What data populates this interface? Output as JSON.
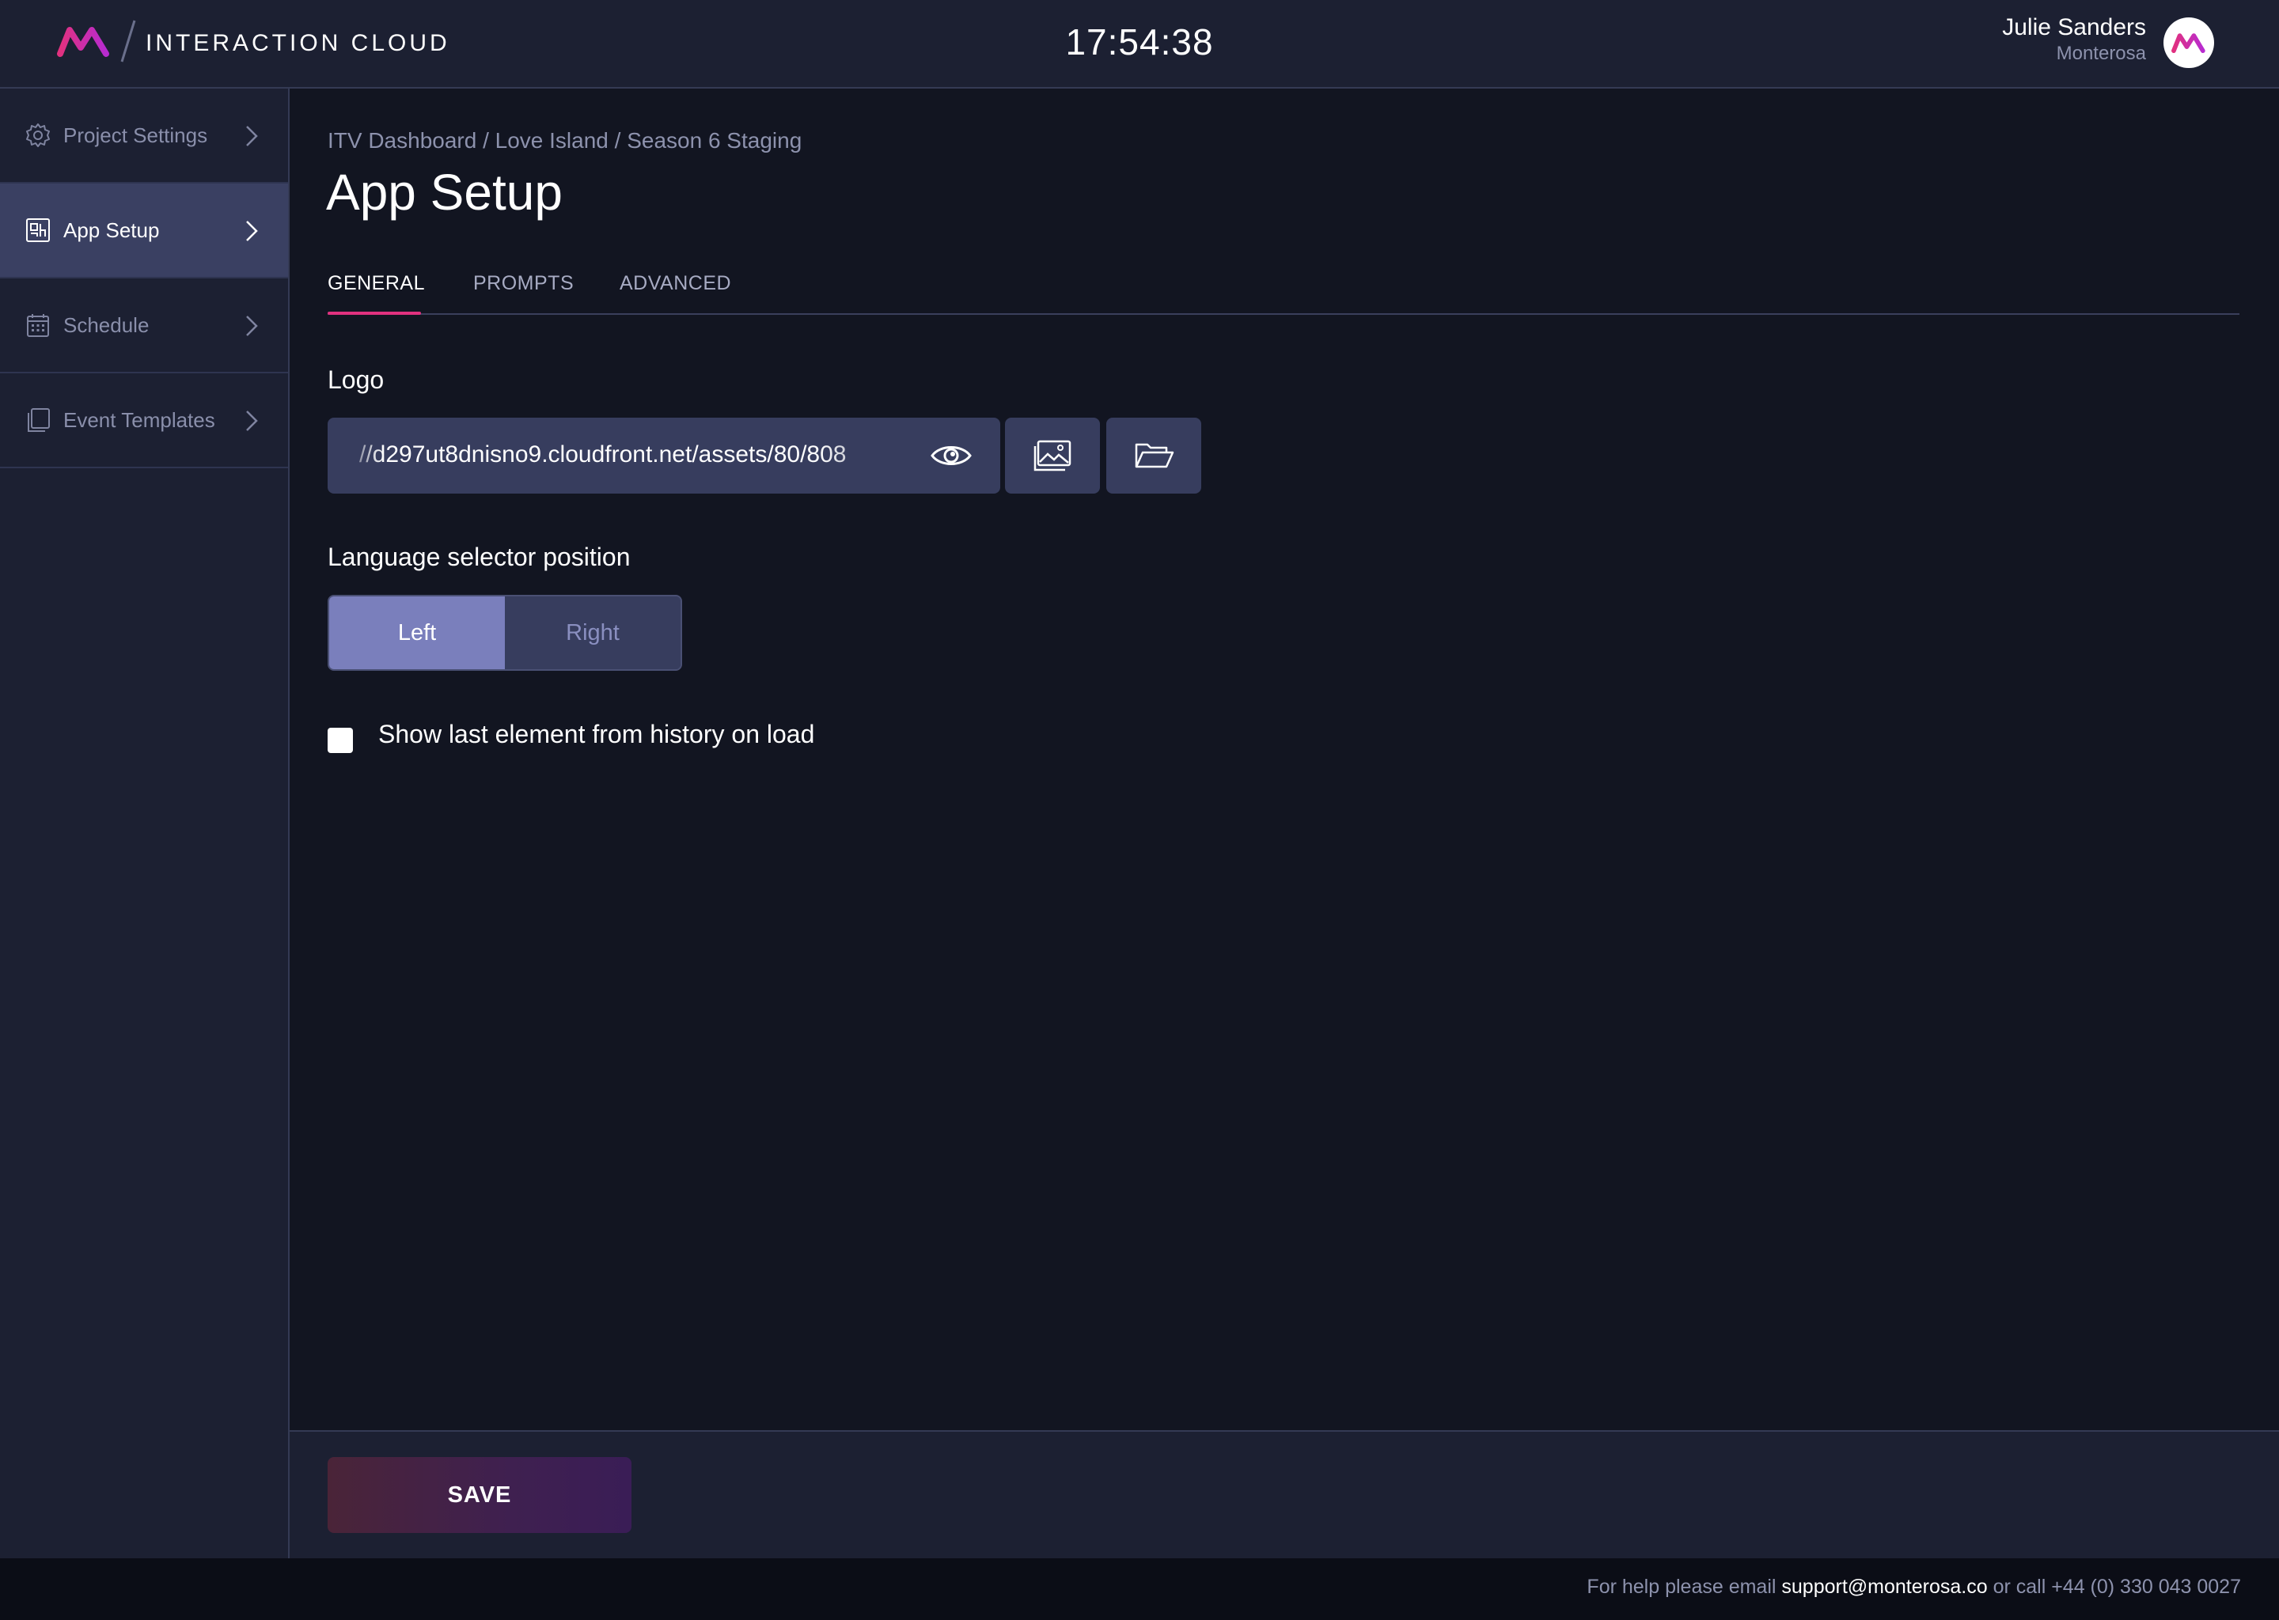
{
  "header": {
    "brand_name": "INTERACTION CLOUD",
    "clock": "17:54:38",
    "user_name": "Julie Sanders",
    "user_org": "Monterosa",
    "accent_color": "#e1317f"
  },
  "sidebar": {
    "items": [
      {
        "label": "Project Settings",
        "icon": "gear-icon",
        "active": false
      },
      {
        "label": "App Setup",
        "icon": "app-setup-icon",
        "active": true
      },
      {
        "label": "Schedule",
        "icon": "calendar-icon",
        "active": false
      },
      {
        "label": "Event Templates",
        "icon": "templates-icon",
        "active": false
      }
    ]
  },
  "main": {
    "breadcrumb": "ITV Dashboard / Love Island / Season 6 Staging",
    "title": "App Setup",
    "tabs": [
      {
        "label": "GENERAL",
        "active": true
      },
      {
        "label": "PROMPTS",
        "active": false
      },
      {
        "label": "ADVANCED",
        "active": false
      }
    ],
    "logo": {
      "label": "Logo",
      "value": "//d297ut8dnisno9.cloudfront.net/assets/80/808"
    },
    "language_selector": {
      "label": "Language selector position",
      "options": [
        "Left",
        "Right"
      ],
      "selected": "Left"
    },
    "history_checkbox": {
      "label": "Show last element from history on load",
      "checked": false
    }
  },
  "actions": {
    "save_label": "SAVE"
  },
  "footer": {
    "prefix": "For help please email ",
    "email": "support@monterosa.co",
    "suffix": " or call +44 (0) 330 043 0027"
  }
}
